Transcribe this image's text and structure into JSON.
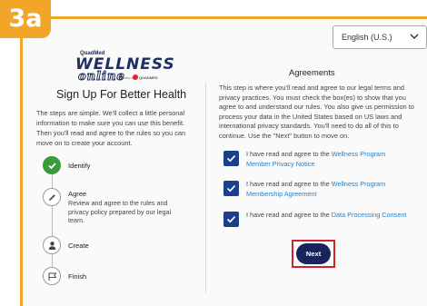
{
  "badge": {
    "label": "3a"
  },
  "language": {
    "selected": "English (U.S.)"
  },
  "logo": {
    "maker": "QuadMed",
    "wordmark": "WELLNESS",
    "wordmark_sub": "online",
    "powered_by": "powered by",
    "brand": "QUADMED"
  },
  "left": {
    "title": "Sign Up For Better Health",
    "intro": "The steps are simple. We'll collect a little personal information to make sure you can use this benefit. Then you'll read and agree to the rules so you can move on to create your account.",
    "steps": [
      {
        "label": "Identify",
        "status": "done",
        "icon": "check-icon"
      },
      {
        "label": "Agree",
        "status": "current",
        "icon": "pencil-icon",
        "description": "Review and agree to the rules and privacy policy prepared by our legal team."
      },
      {
        "label": "Create",
        "status": "pending",
        "icon": "person-icon"
      },
      {
        "label": "Finish",
        "status": "pending",
        "icon": "flag-icon"
      }
    ]
  },
  "right": {
    "title": "Agreements",
    "intro": "This step is where you'll read and agree to our legal terms and privacy practices. You must check the box(es) to show that you agree to and understand our rules. You also give us permission to process your data in the United States based on US laws and international privacy standards. You'll need to do all of this to continue. Use the \"Next\" button to move on.",
    "agreements": [
      {
        "prefix": "I have read and agree to the ",
        "link": "Wellness Program Member Privacy Notice",
        "checked": true
      },
      {
        "prefix": "I have read and agree to the ",
        "link": "Wellness Program Membership Agreement",
        "checked": true
      },
      {
        "prefix": "I have read and agree to the ",
        "link": "Data Processing Consent",
        "checked": true
      }
    ],
    "next_label": "Next"
  },
  "colors": {
    "badge": "#f3a52a",
    "checkbox": "#1c3f8c",
    "next_button": "#16255c",
    "highlight": "#d22129",
    "done_step": "#3b9a3b",
    "link": "#2a7fc0"
  }
}
